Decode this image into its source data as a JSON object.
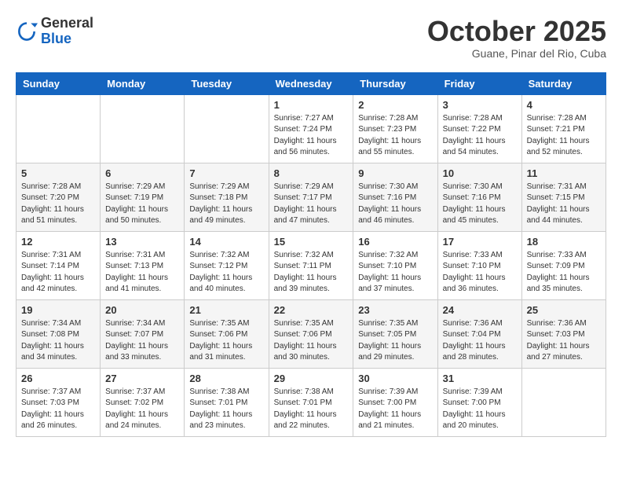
{
  "header": {
    "logo_general": "General",
    "logo_blue": "Blue",
    "month_title": "October 2025",
    "subtitle": "Guane, Pinar del Rio, Cuba"
  },
  "days_of_week": [
    "Sunday",
    "Monday",
    "Tuesday",
    "Wednesday",
    "Thursday",
    "Friday",
    "Saturday"
  ],
  "weeks": [
    [
      {
        "day": "",
        "info": ""
      },
      {
        "day": "",
        "info": ""
      },
      {
        "day": "",
        "info": ""
      },
      {
        "day": "1",
        "info": "Sunrise: 7:27 AM\nSunset: 7:24 PM\nDaylight: 11 hours\nand 56 minutes."
      },
      {
        "day": "2",
        "info": "Sunrise: 7:28 AM\nSunset: 7:23 PM\nDaylight: 11 hours\nand 55 minutes."
      },
      {
        "day": "3",
        "info": "Sunrise: 7:28 AM\nSunset: 7:22 PM\nDaylight: 11 hours\nand 54 minutes."
      },
      {
        "day": "4",
        "info": "Sunrise: 7:28 AM\nSunset: 7:21 PM\nDaylight: 11 hours\nand 52 minutes."
      }
    ],
    [
      {
        "day": "5",
        "info": "Sunrise: 7:28 AM\nSunset: 7:20 PM\nDaylight: 11 hours\nand 51 minutes."
      },
      {
        "day": "6",
        "info": "Sunrise: 7:29 AM\nSunset: 7:19 PM\nDaylight: 11 hours\nand 50 minutes."
      },
      {
        "day": "7",
        "info": "Sunrise: 7:29 AM\nSunset: 7:18 PM\nDaylight: 11 hours\nand 49 minutes."
      },
      {
        "day": "8",
        "info": "Sunrise: 7:29 AM\nSunset: 7:17 PM\nDaylight: 11 hours\nand 47 minutes."
      },
      {
        "day": "9",
        "info": "Sunrise: 7:30 AM\nSunset: 7:16 PM\nDaylight: 11 hours\nand 46 minutes."
      },
      {
        "day": "10",
        "info": "Sunrise: 7:30 AM\nSunset: 7:16 PM\nDaylight: 11 hours\nand 45 minutes."
      },
      {
        "day": "11",
        "info": "Sunrise: 7:31 AM\nSunset: 7:15 PM\nDaylight: 11 hours\nand 44 minutes."
      }
    ],
    [
      {
        "day": "12",
        "info": "Sunrise: 7:31 AM\nSunset: 7:14 PM\nDaylight: 11 hours\nand 42 minutes."
      },
      {
        "day": "13",
        "info": "Sunrise: 7:31 AM\nSunset: 7:13 PM\nDaylight: 11 hours\nand 41 minutes."
      },
      {
        "day": "14",
        "info": "Sunrise: 7:32 AM\nSunset: 7:12 PM\nDaylight: 11 hours\nand 40 minutes."
      },
      {
        "day": "15",
        "info": "Sunrise: 7:32 AM\nSunset: 7:11 PM\nDaylight: 11 hours\nand 39 minutes."
      },
      {
        "day": "16",
        "info": "Sunrise: 7:32 AM\nSunset: 7:10 PM\nDaylight: 11 hours\nand 37 minutes."
      },
      {
        "day": "17",
        "info": "Sunrise: 7:33 AM\nSunset: 7:10 PM\nDaylight: 11 hours\nand 36 minutes."
      },
      {
        "day": "18",
        "info": "Sunrise: 7:33 AM\nSunset: 7:09 PM\nDaylight: 11 hours\nand 35 minutes."
      }
    ],
    [
      {
        "day": "19",
        "info": "Sunrise: 7:34 AM\nSunset: 7:08 PM\nDaylight: 11 hours\nand 34 minutes."
      },
      {
        "day": "20",
        "info": "Sunrise: 7:34 AM\nSunset: 7:07 PM\nDaylight: 11 hours\nand 33 minutes."
      },
      {
        "day": "21",
        "info": "Sunrise: 7:35 AM\nSunset: 7:06 PM\nDaylight: 11 hours\nand 31 minutes."
      },
      {
        "day": "22",
        "info": "Sunrise: 7:35 AM\nSunset: 7:06 PM\nDaylight: 11 hours\nand 30 minutes."
      },
      {
        "day": "23",
        "info": "Sunrise: 7:35 AM\nSunset: 7:05 PM\nDaylight: 11 hours\nand 29 minutes."
      },
      {
        "day": "24",
        "info": "Sunrise: 7:36 AM\nSunset: 7:04 PM\nDaylight: 11 hours\nand 28 minutes."
      },
      {
        "day": "25",
        "info": "Sunrise: 7:36 AM\nSunset: 7:03 PM\nDaylight: 11 hours\nand 27 minutes."
      }
    ],
    [
      {
        "day": "26",
        "info": "Sunrise: 7:37 AM\nSunset: 7:03 PM\nDaylight: 11 hours\nand 26 minutes."
      },
      {
        "day": "27",
        "info": "Sunrise: 7:37 AM\nSunset: 7:02 PM\nDaylight: 11 hours\nand 24 minutes."
      },
      {
        "day": "28",
        "info": "Sunrise: 7:38 AM\nSunset: 7:01 PM\nDaylight: 11 hours\nand 23 minutes."
      },
      {
        "day": "29",
        "info": "Sunrise: 7:38 AM\nSunset: 7:01 PM\nDaylight: 11 hours\nand 22 minutes."
      },
      {
        "day": "30",
        "info": "Sunrise: 7:39 AM\nSunset: 7:00 PM\nDaylight: 11 hours\nand 21 minutes."
      },
      {
        "day": "31",
        "info": "Sunrise: 7:39 AM\nSunset: 7:00 PM\nDaylight: 11 hours\nand 20 minutes."
      },
      {
        "day": "",
        "info": ""
      }
    ]
  ]
}
